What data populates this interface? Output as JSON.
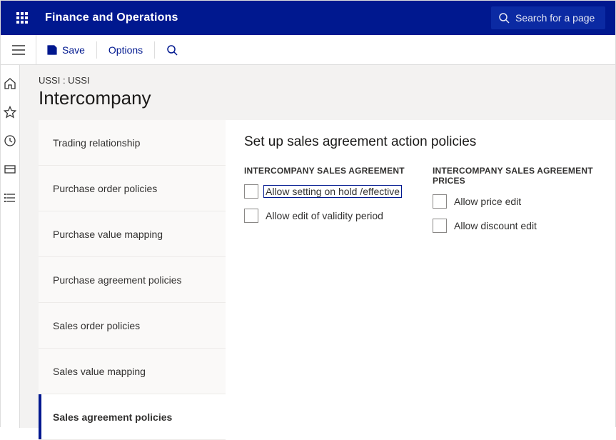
{
  "brand": "Finance and Operations",
  "search_placeholder": "Search for a page",
  "toolbar": {
    "save": "Save",
    "options": "Options"
  },
  "breadcrumb": "USSI : USSI",
  "page_title": "Intercompany",
  "tabs": [
    "Trading relationship",
    "Purchase order policies",
    "Purchase value mapping",
    "Purchase agreement policies",
    "Sales order policies",
    "Sales value mapping",
    "Sales agreement policies"
  ],
  "content": {
    "heading": "Set up sales agreement action policies",
    "group1": {
      "title": "INTERCOMPANY SALES AGREEMENT",
      "opt1": "Allow setting on hold /effective",
      "opt2": "Allow edit of validity period"
    },
    "group2": {
      "title": "INTERCOMPANY SALES AGREEMENT PRICES",
      "opt1": "Allow price edit",
      "opt2": "Allow discount edit"
    }
  }
}
